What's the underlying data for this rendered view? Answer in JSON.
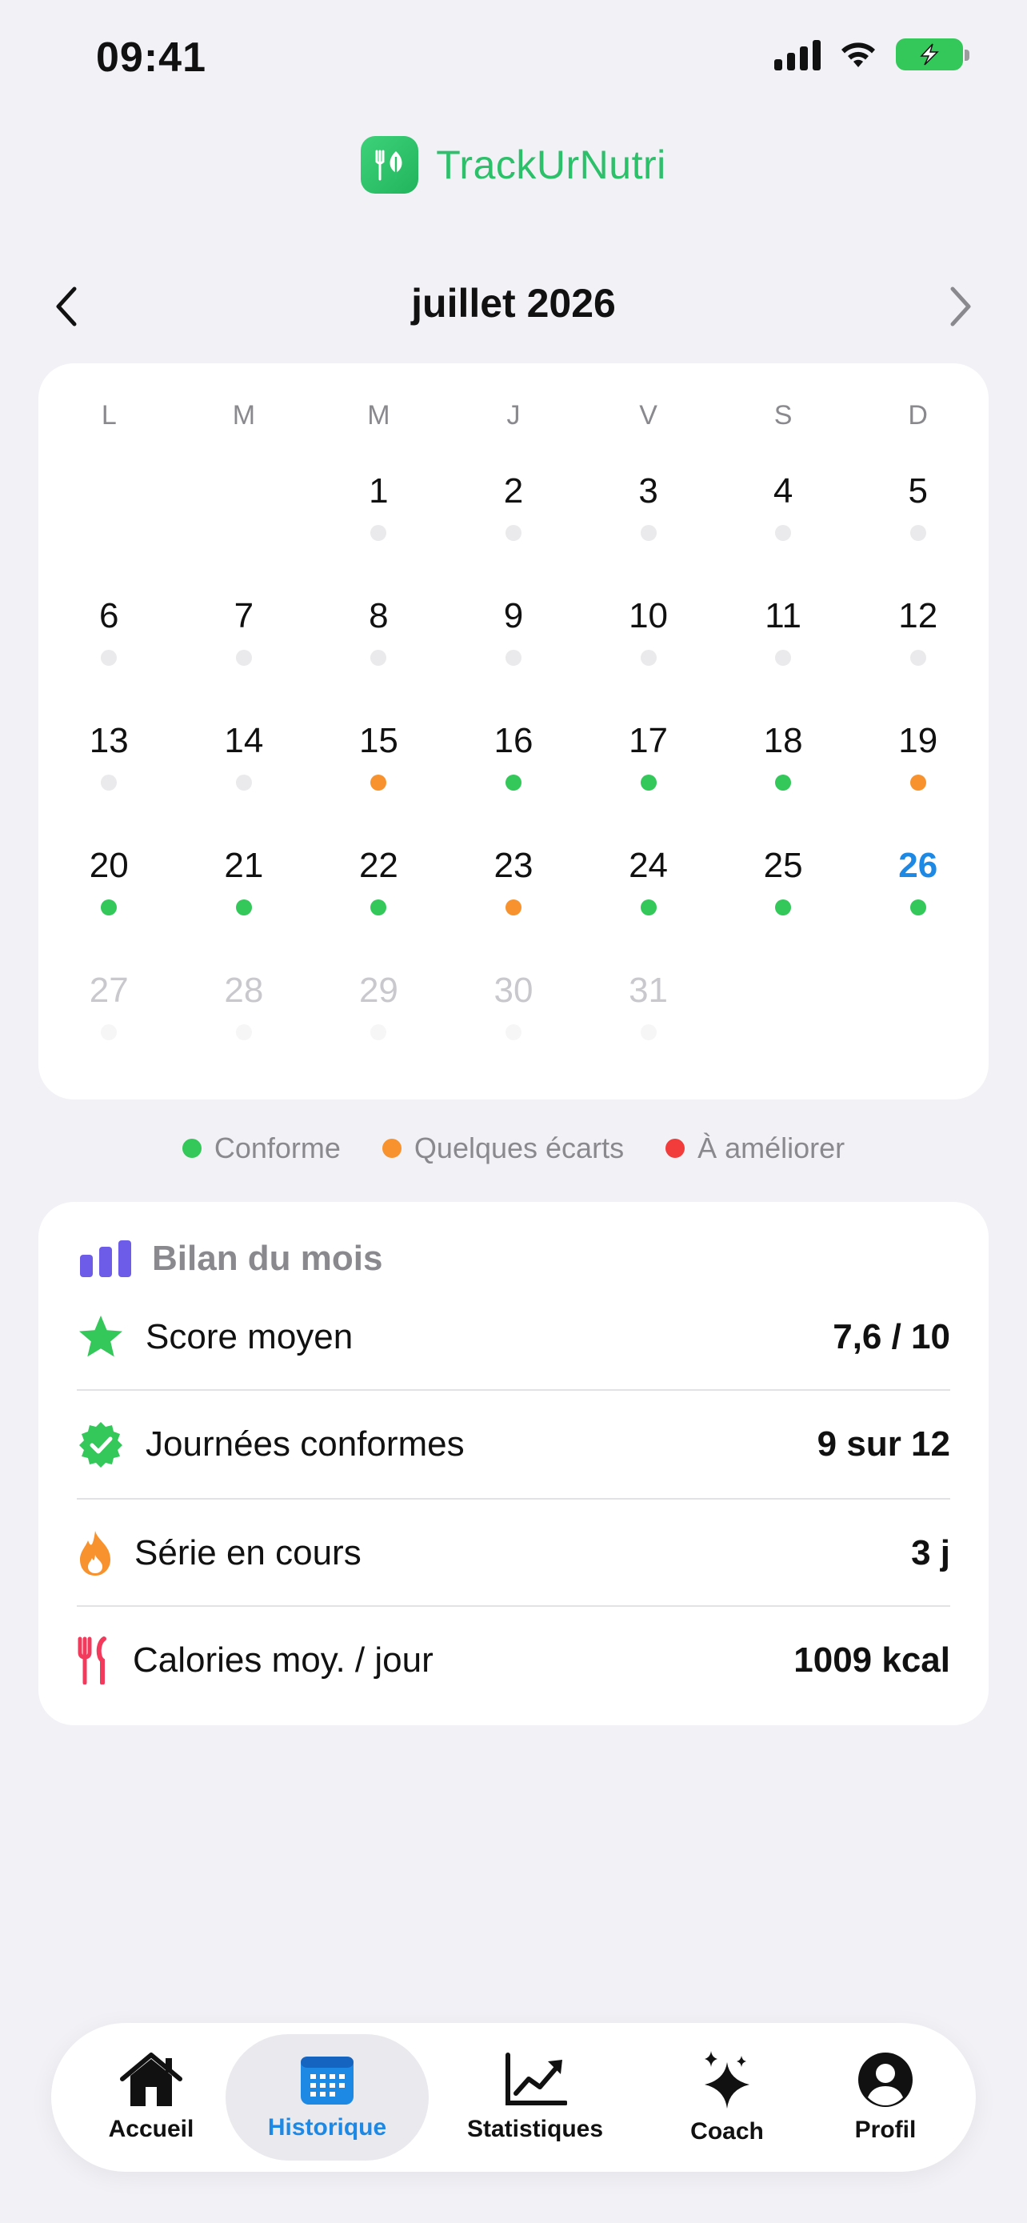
{
  "status_bar": {
    "time": "09:41"
  },
  "brand": {
    "name": "TrackUrNutri"
  },
  "calendar": {
    "month_title": "juillet 2026",
    "weekdays": [
      "L",
      "M",
      "M",
      "J",
      "V",
      "S",
      "D"
    ],
    "today": 26,
    "days": [
      {
        "n": "1",
        "status": "none"
      },
      {
        "n": "2",
        "status": "none"
      },
      {
        "n": "3",
        "status": "none"
      },
      {
        "n": "4",
        "status": "none"
      },
      {
        "n": "5",
        "status": "none"
      },
      {
        "n": "6",
        "status": "none"
      },
      {
        "n": "7",
        "status": "none"
      },
      {
        "n": "8",
        "status": "none"
      },
      {
        "n": "9",
        "status": "none"
      },
      {
        "n": "10",
        "status": "none"
      },
      {
        "n": "11",
        "status": "none"
      },
      {
        "n": "12",
        "status": "none"
      },
      {
        "n": "13",
        "status": "none"
      },
      {
        "n": "14",
        "status": "none"
      },
      {
        "n": "15",
        "status": "orange"
      },
      {
        "n": "16",
        "status": "green"
      },
      {
        "n": "17",
        "status": "green"
      },
      {
        "n": "18",
        "status": "green"
      },
      {
        "n": "19",
        "status": "orange"
      },
      {
        "n": "20",
        "status": "green"
      },
      {
        "n": "21",
        "status": "green"
      },
      {
        "n": "22",
        "status": "green"
      },
      {
        "n": "23",
        "status": "orange"
      },
      {
        "n": "24",
        "status": "green"
      },
      {
        "n": "25",
        "status": "green"
      },
      {
        "n": "26",
        "status": "green"
      },
      {
        "n": "27",
        "status": "future"
      },
      {
        "n": "28",
        "status": "future"
      },
      {
        "n": "29",
        "status": "future"
      },
      {
        "n": "30",
        "status": "future"
      },
      {
        "n": "31",
        "status": "future"
      }
    ],
    "first_weekday_index": 2
  },
  "legend": [
    {
      "label": "Conforme",
      "color": "#34C759"
    },
    {
      "label": "Quelques écarts",
      "color": "#F7922E"
    },
    {
      "label": "À améliorer",
      "color": "#F23B3B"
    }
  ],
  "summary": {
    "title": "Bilan du mois",
    "rows": [
      {
        "label": "Score moyen",
        "value": "7,6 / 10",
        "icon": "star-icon"
      },
      {
        "label": "Journées conformes",
        "value": "9 sur 12",
        "icon": "verified-badge-icon"
      },
      {
        "label": "Série en cours",
        "value": "3 j",
        "icon": "flame-icon"
      },
      {
        "label": "Calories moy. / jour",
        "value": "1009 kcal",
        "icon": "fork-knife-icon"
      }
    ]
  },
  "tabs": [
    {
      "label": "Accueil",
      "icon": "home-icon",
      "active": false
    },
    {
      "label": "Historique",
      "icon": "calendar-icon",
      "active": true
    },
    {
      "label": "Statistiques",
      "icon": "chart-icon",
      "active": false
    },
    {
      "label": "Coach",
      "icon": "sparkles-icon",
      "active": false
    },
    {
      "label": "Profil",
      "icon": "profile-icon",
      "active": false
    }
  ],
  "colors": {
    "brand": "#2DC06A",
    "accent": "#1E88E5",
    "conforme": "#34C759",
    "ecarts": "#F7922E",
    "ameliorer": "#F23B3B",
    "bilan_icon": "#6C5CE7"
  }
}
